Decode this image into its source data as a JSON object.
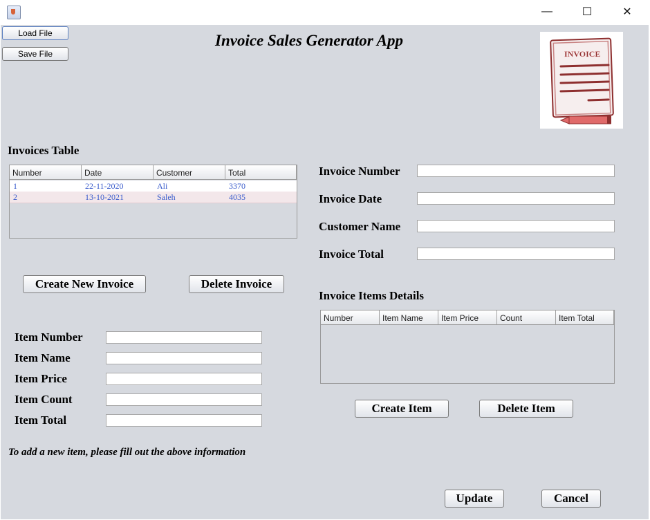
{
  "window": {
    "minimize": "—",
    "maximize": "☐",
    "close": "✕"
  },
  "toolbar": {
    "load_file": "Load File",
    "save_file": "Save File"
  },
  "app_title": "Invoice Sales Generator App",
  "logo": {
    "text": "INVOICE",
    "colors": {
      "stroke": "#8e2f2f",
      "pencil": "#e06a6a"
    }
  },
  "invoices_table": {
    "title": "Invoices Table",
    "columns": [
      "Number",
      "Date",
      "Customer",
      "Total"
    ],
    "rows": [
      [
        "1",
        "22-11-2020",
        "Ali",
        "3370"
      ],
      [
        "2",
        "13-10-2021",
        "Saleh",
        "4035"
      ]
    ]
  },
  "invoice_buttons": {
    "create": "Create New Invoice",
    "delete": "Delete Invoice"
  },
  "invoice_form": {
    "number_label": "Invoice Number",
    "number_value": "",
    "date_label": "Invoice Date",
    "date_value": "",
    "customer_label": "Customer Name",
    "customer_value": "",
    "total_label": "Invoice Total",
    "total_value": ""
  },
  "items_table": {
    "title": "Invoice Items Details",
    "columns": [
      "Number",
      "Item Name",
      "Item Price",
      "Count",
      "Item Total"
    ]
  },
  "item_buttons": {
    "create": "Create Item",
    "delete": "Delete Item"
  },
  "item_form": {
    "number_label": "Item Number",
    "name_label": "Item Name",
    "price_label": "Item Price",
    "count_label": "Item Count",
    "total_label": "Item Total",
    "number_value": "",
    "name_value": "",
    "price_value": "",
    "count_value": "",
    "total_value": ""
  },
  "hint": "To add a new item, please fill out the above information",
  "footer": {
    "update": "Update",
    "cancel": "Cancel"
  },
  "colors": {
    "background": "#d6d9df",
    "row_text": "#3a5ccc",
    "row_alt": "#f3e7ea"
  }
}
